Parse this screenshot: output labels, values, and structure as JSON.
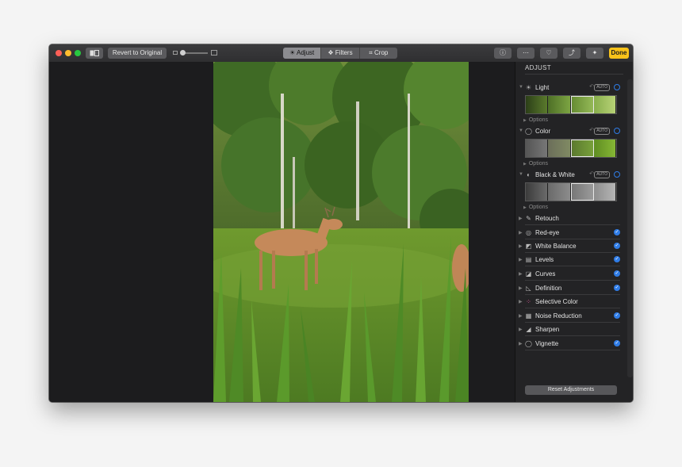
{
  "toolbar": {
    "revert_label": "Revert to Original",
    "tabs": [
      {
        "label": "Adjust",
        "icon": "sun-icon",
        "active": true
      },
      {
        "label": "Filters",
        "icon": "filters-icon",
        "active": false
      },
      {
        "label": "Crop",
        "icon": "crop-icon",
        "active": false
      }
    ],
    "done_label": "Done"
  },
  "panel": {
    "title": "ADJUST",
    "sections": [
      {
        "label": "Light",
        "icon": "sun-icon",
        "auto": "AUTO",
        "options": "Options"
      },
      {
        "label": "Color",
        "icon": "color-circle-icon",
        "auto": "AUTO",
        "options": "Options"
      },
      {
        "label": "Black & White",
        "icon": "half-circle-icon",
        "auto": "AUTO",
        "options": "Options"
      }
    ],
    "items": [
      {
        "label": "Retouch",
        "icon": "bandage-icon",
        "checked": false
      },
      {
        "label": "Red-eye",
        "icon": "eye-icon",
        "checked": true
      },
      {
        "label": "White Balance",
        "icon": "white-balance-icon",
        "checked": true
      },
      {
        "label": "Levels",
        "icon": "levels-icon",
        "checked": true
      },
      {
        "label": "Curves",
        "icon": "curves-icon",
        "checked": true
      },
      {
        "label": "Definition",
        "icon": "definition-icon",
        "checked": true
      },
      {
        "label": "Selective Color",
        "icon": "selective-color-icon",
        "checked": false
      },
      {
        "label": "Noise Reduction",
        "icon": "noise-icon",
        "checked": true
      },
      {
        "label": "Sharpen",
        "icon": "sharpen-icon",
        "checked": false
      },
      {
        "label": "Vignette",
        "icon": "vignette-icon",
        "checked": true
      }
    ],
    "reset_label": "Reset Adjustments"
  },
  "colors": {
    "accent": "#2f7ce6",
    "done": "#f8c21a"
  }
}
